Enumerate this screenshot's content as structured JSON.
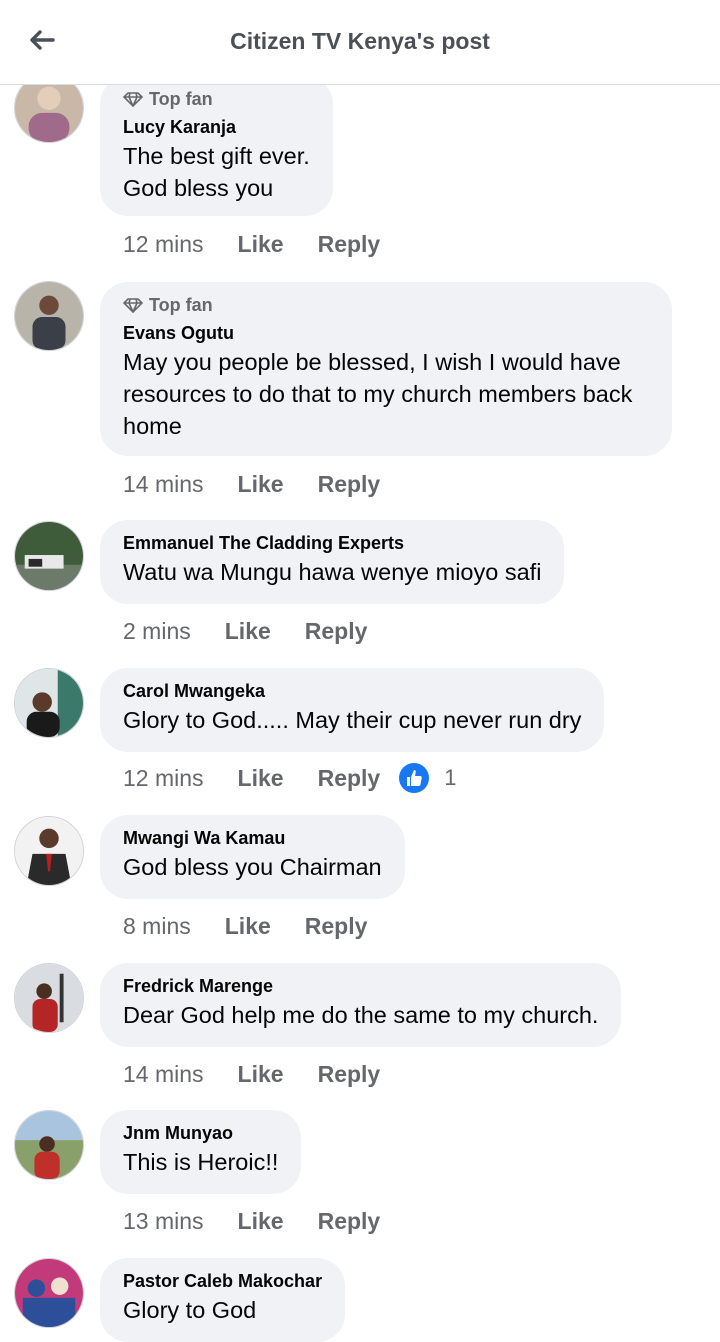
{
  "header": {
    "title": "Citizen TV Kenya's post"
  },
  "actions": {
    "like": "Like",
    "reply": "Reply"
  },
  "badge_label": "Top fan",
  "comments": [
    {
      "name": "Lucy Karanja",
      "top_fan": true,
      "text": "The best gift ever.\nGod bless you",
      "time": "12 mins"
    },
    {
      "name": "Evans Ogutu",
      "top_fan": true,
      "text": "May you people be blessed, I wish I would have\nresources to do that to my church members back\nhome",
      "time": "14 mins"
    },
    {
      "name": "Emmanuel The Cladding Experts",
      "top_fan": false,
      "text": "Watu wa Mungu hawa wenye mioyo safi",
      "time": "2 mins"
    },
    {
      "name": "Carol Mwangeka",
      "top_fan": false,
      "text": "Glory to God..... May their cup never run dry",
      "time": "12 mins",
      "reactions": "1"
    },
    {
      "name": "Mwangi Wa Kamau",
      "top_fan": false,
      "text": "God bless you Chairman",
      "time": "8 mins"
    },
    {
      "name": "Fredrick Marenge",
      "top_fan": false,
      "text": "Dear God help me do the same to my church.",
      "time": "14 mins"
    },
    {
      "name": "Jnm Munyao",
      "top_fan": false,
      "text": "This is Heroic!!",
      "time": "13 mins"
    },
    {
      "name": "Pastor Caleb Makochar",
      "top_fan": false,
      "text": "Glory to God"
    }
  ],
  "avatars": [
    {
      "bg": "#c9b7a8",
      "fg": "#a06a8a",
      "icon": "user-avatar"
    },
    {
      "bg": "#b9b4aa",
      "fg": "#3b3f48",
      "icon": "user-avatar"
    },
    {
      "bg": "#3e5b3a",
      "fg": "#e8e8e8",
      "icon": "user-avatar"
    },
    {
      "bg": "#dfe6e8",
      "fg": "#1a1a1a",
      "icon": "user-avatar"
    },
    {
      "bg": "#f2f2f2",
      "fg": "#2a2a2a",
      "icon": "user-avatar"
    },
    {
      "bg": "#d9dde2",
      "fg": "#b52525",
      "icon": "user-avatar"
    },
    {
      "bg": "#8aa06a",
      "fg": "#c0302a",
      "icon": "user-avatar"
    },
    {
      "bg": "#c23a7a",
      "fg": "#2d4f9a",
      "icon": "user-avatar"
    }
  ],
  "colors": {
    "like_badge": "#1877f2",
    "bubble": "#f0f2f5",
    "muted": "#65676b"
  }
}
